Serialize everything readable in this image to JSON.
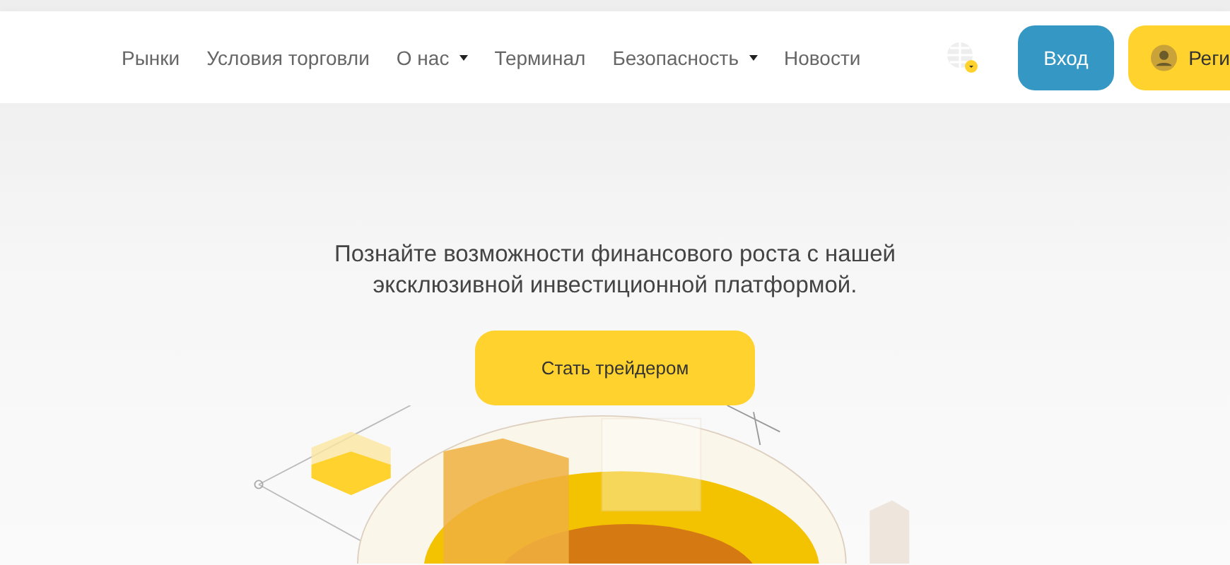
{
  "nav": [
    {
      "label": "Рынки",
      "has_dropdown": false
    },
    {
      "label": "Условия торговли",
      "has_dropdown": false
    },
    {
      "label": "О нас",
      "has_dropdown": true
    },
    {
      "label": "Терминал",
      "has_dropdown": false
    },
    {
      "label": "Безопасность",
      "has_dropdown": true
    },
    {
      "label": "Новости",
      "has_dropdown": false
    }
  ],
  "login_button": "Вход",
  "register_button": "Реги",
  "hero": {
    "text": "Познайте возможности финансового роста с нашей эксклюзивной инвестиционной платформой.",
    "cta": "Стать трейдером"
  }
}
